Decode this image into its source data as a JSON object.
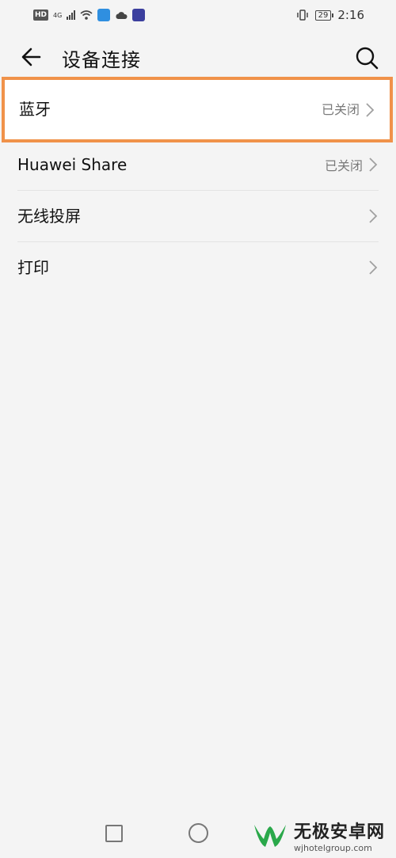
{
  "status_bar": {
    "left_icons": [
      "hd-icon",
      "4g-icon",
      "signal-icon",
      "wifi-icon",
      "app-notify-icon",
      "cloud-icon",
      "app-badge-icon"
    ],
    "network_label": "4G",
    "hd_label": "HD",
    "battery_level": "29",
    "time": "2:16"
  },
  "header": {
    "title": "设备连接",
    "back_icon": "arrow-left-icon",
    "search_icon": "search-icon"
  },
  "highlighted_item": {
    "label": "蓝牙",
    "value": "已关闭",
    "highlight_color": "#f0924a"
  },
  "items": [
    {
      "label": "Huawei Share",
      "value": "已关闭"
    },
    {
      "label": "无线投屏",
      "value": ""
    },
    {
      "label": "打印",
      "value": ""
    }
  ],
  "navigation": {
    "square_icon": "recent-apps-icon",
    "circle_icon": "home-icon"
  },
  "watermark": {
    "title": "无极安卓网",
    "url": "wjhotelgroup.com"
  }
}
